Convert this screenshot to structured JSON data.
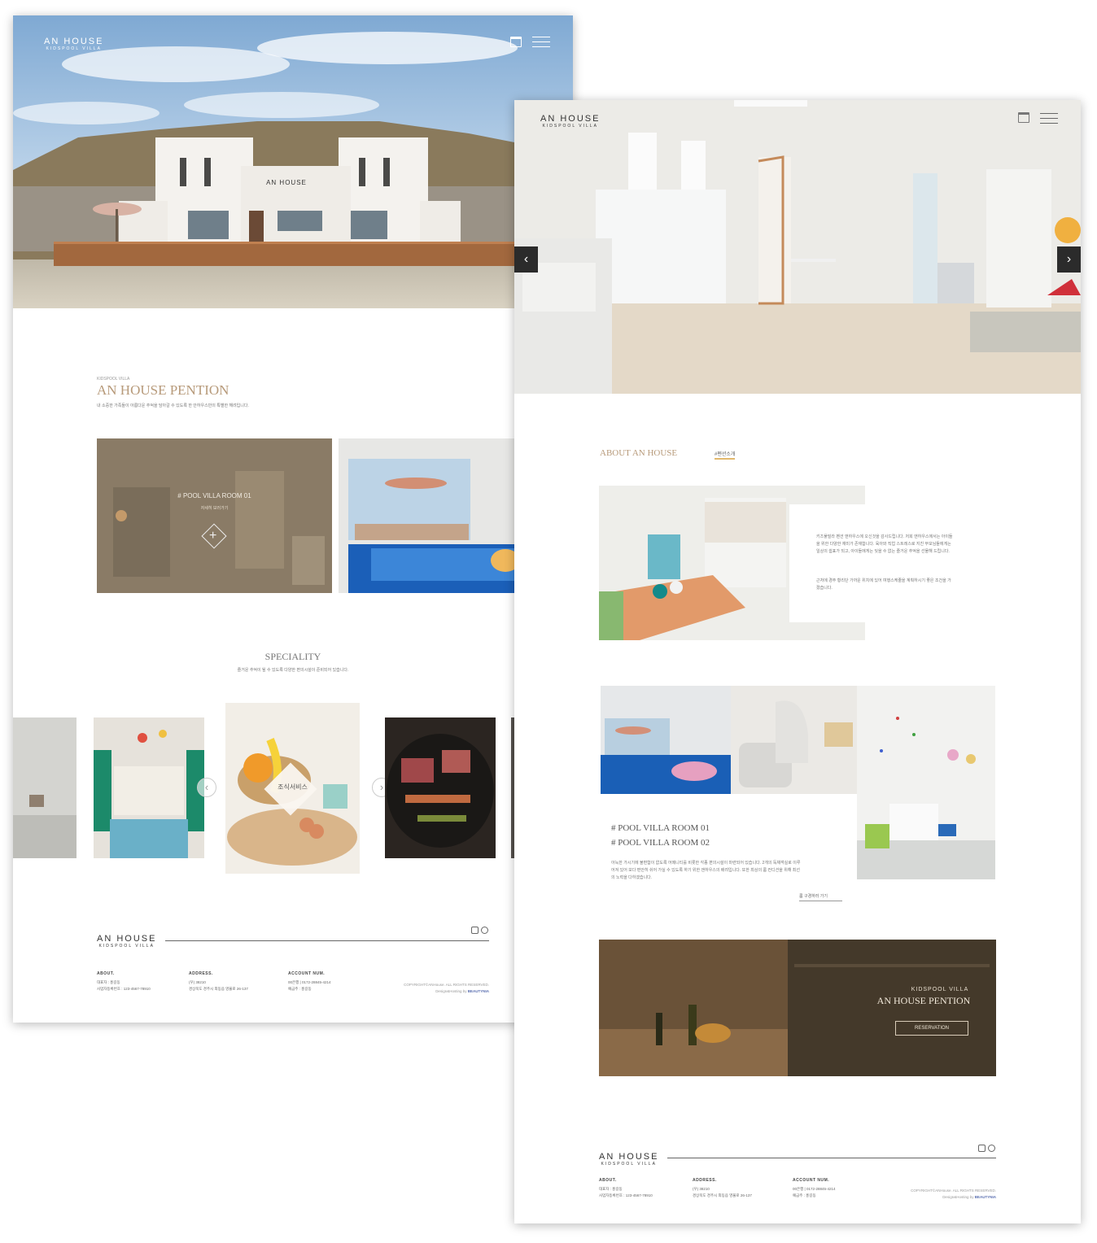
{
  "brand": {
    "name": "AN HOUSE",
    "tagline": "KIDSPOOL VILLA"
  },
  "colors": {
    "accent": "#b79a7a",
    "gold": "#e2b86d",
    "dark_banner": "#3f3527"
  },
  "main_page": {
    "intro": {
      "kicker": "KIDSPOOL VILLA",
      "title": "AN HOUSE PENTION",
      "desc": "내 소중한 가족들이 아름다운 추억을 담아갈 수 있도록 한 안하우스만의 특별한 해려입니다."
    },
    "room_card": {
      "title": "# POOL VILLA ROOM 01",
      "link": "자세히 보러가기"
    },
    "speciality": {
      "title": "SPECIALITY",
      "desc": "즐거운 추억이 될 수 있도록 다양한 편의시설이 준비되어 있습니다.",
      "center_label": "조식서비스"
    },
    "footer": {
      "about_title": "ABOUT.",
      "about_lines": [
        "대표자 : 홍길동",
        "사업자등록번호 : 123-4567-78910"
      ],
      "address_title": "ADDRESS.",
      "address_lines": [
        "(우) 38210",
        "경상북도 경주시 외동읍 영불로 26-137"
      ],
      "account_title": "ACCOUNT NUM.",
      "account_lines": [
        "00은행 | 0172-28845-4214",
        "예금주 : 홍길동"
      ],
      "copyright": "COPYRIGHT©ANHouse. ALL RIGHTS RESERVED.",
      "design_credit": "Design&Hosting by",
      "design_brand": "BEAUTYNIA"
    }
  },
  "sub_page": {
    "about": {
      "title": "ABOUT AN HOUSE",
      "tag": "#펜션소개",
      "para1": "키즈풀빌라 펜션 앤하우스에 오신것을 감사드립니다. 저희 앤하우스에서는 아이들을 위한 다양한 재미가 존재합니다. 육아와 직업 스트레스로 지친 부모님들에게는 일상의 쉼표가 되고, 아이들에게는 잊을 수 없는 즐거운 추억을 선물해 드립니다.",
      "para2": "근처에 경주 황리단 가까운 위치에 있어 여행스케줄을 계획하시기 좋은 조건을 가졌습니다."
    },
    "rooms": {
      "room1": "# POOL VILLA ROOM 01",
      "room2": "# POOL VILLA ROOM 02",
      "desc": "아늑한 가시기에 불편함이 없도록 어메니티를 비롯한 각종 편의시설이 마련되어 있습니다. 2개의 독채객실로 이루어져 있어 보다 편안히 쉬어 가실 수 있도록 하기 위한 앤하우스의 배려입니다. 또한 최상의 룸 컨디션을 위해 최선의 노력을 다하겠습니다.",
      "link": "룸 구경하러 가기"
    },
    "banner": {
      "kicker": "KIDSPOOL VILLA",
      "title": "AN HOUSE PENTION",
      "button": "RESERVATION"
    },
    "footer": {
      "about_title": "ABOUT.",
      "about_lines": [
        "대표자 : 홍길동",
        "사업자등록번호 : 123-4567-78910"
      ],
      "address_title": "ADDRESS.",
      "address_lines": [
        "(우) 38210",
        "경상북도 경주시 외동읍 영불로 26-137"
      ],
      "account_title": "ACCOUNT NUM.",
      "account_lines": [
        "00은행 | 0172-28845-4214",
        "예금주 : 홍길동"
      ],
      "copyright": "COPYRIGHT©ANHouse. ALL RIGHTS RESERVED.",
      "design_credit": "Design&Hosting by",
      "design_brand": "BEAUTYNIA"
    }
  }
}
